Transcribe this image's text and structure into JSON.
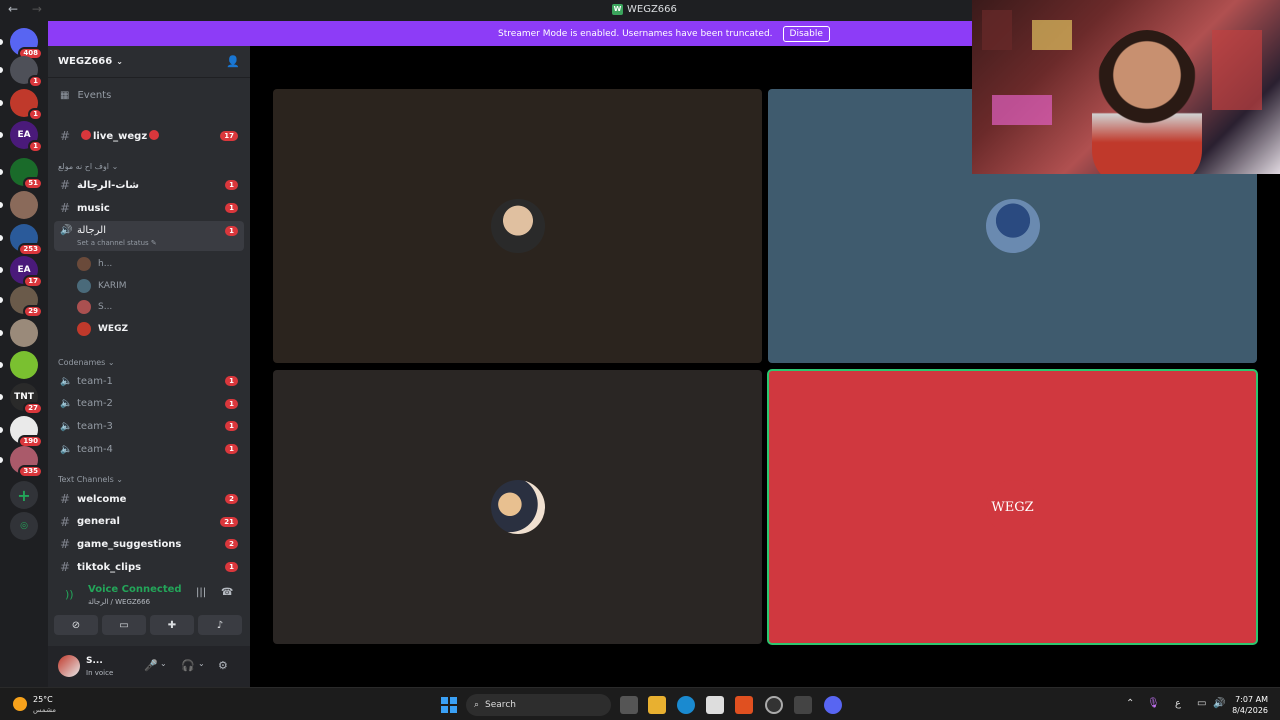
{
  "window": {
    "back": "←",
    "forward": "→",
    "title": "WEGZ666",
    "title_icon": "W"
  },
  "banner": {
    "text": "Streamer Mode is enabled. Usernames have been truncated.",
    "button": "Disable"
  },
  "servers": [
    {
      "name": "discord-home-icon",
      "badge": "408",
      "color": "#5865f2"
    },
    {
      "name": "server-2",
      "badge": "1",
      "color": "#4e5058"
    },
    {
      "name": "server-3",
      "badge": "1",
      "color": "#c0392b"
    },
    {
      "name": "server-ea",
      "badge": "1",
      "color": "#4a1a7a",
      "text": "EA"
    },
    {
      "name": "server-green",
      "badge": "51",
      "color": "#1a6b2a"
    },
    {
      "name": "server-6",
      "badge": "",
      "color": "#8a6a5a"
    },
    {
      "name": "server-7",
      "badge": "253",
      "color": "#2a5a9a"
    },
    {
      "name": "server-ea2",
      "badge": "17",
      "color": "#4a1a7a",
      "text": "EA"
    },
    {
      "name": "server-9",
      "badge": "29",
      "color": "#6a5a4a"
    },
    {
      "name": "server-10",
      "badge": "",
      "color": "#9a8a7a"
    },
    {
      "name": "server-11",
      "badge": "",
      "color": "#7ac030"
    },
    {
      "name": "server-tnt",
      "badge": "27",
      "color": "#2a2a2a",
      "text": "TNT"
    },
    {
      "name": "server-13",
      "badge": "190",
      "color": "#eaeaea"
    },
    {
      "name": "server-14",
      "badge": "335",
      "color": "#aa5a6a"
    }
  ],
  "sidebar": {
    "server_name": "WEGZ666",
    "events": "Events",
    "live_channel": "live_wegz",
    "live_count": "17",
    "category_1": "اوف اح نه مولع",
    "channels_1": [
      {
        "name": "شات-الرجالة",
        "count": "1"
      },
      {
        "name": "music",
        "count": "1"
      }
    ],
    "voice_channel": {
      "name": "الرجالة",
      "sub": "Set a channel status",
      "count": "1"
    },
    "voice_users": [
      {
        "name": "h...",
        "color": "#6a4a3a"
      },
      {
        "name": "KARIM",
        "color": "#4a6a7a"
      },
      {
        "name": "S...",
        "color": "#aa5050"
      },
      {
        "name": "WEGZ",
        "color": "#c0392b"
      }
    ],
    "category_2": "Codenames",
    "team_channels": [
      {
        "name": "team-1",
        "count": "1"
      },
      {
        "name": "team-2",
        "count": "1"
      },
      {
        "name": "team-3",
        "count": "1"
      },
      {
        "name": "team-4",
        "count": "1"
      }
    ],
    "category_3": "Text Channels",
    "text_channels": [
      {
        "name": "welcome",
        "count": "2"
      },
      {
        "name": "general",
        "count": "21"
      },
      {
        "name": "game_suggestions",
        "count": "2"
      },
      {
        "name": "tiktok_clips",
        "count": "1"
      }
    ]
  },
  "voice_panel": {
    "status": "Voice Connected",
    "sub": "الرجالة / WEGZ666"
  },
  "user_panel": {
    "name": "S...",
    "status": "In voice"
  },
  "tiles": [
    {
      "name": "tile-1",
      "bg": "#2b241e",
      "avatar": "#5a5550"
    },
    {
      "name": "tile-2",
      "bg": "#3f5b6e",
      "avatar": "#4a6a90"
    },
    {
      "name": "tile-3",
      "bg": "#2a2624",
      "avatar": "#c8a080"
    },
    {
      "name": "tile-4",
      "bg": "#d0383f",
      "avatar": "#d0383f",
      "label": "WEGZ"
    }
  ],
  "taskbar": {
    "temp": "25°C",
    "weather_desc": "مشمس",
    "search": "Search",
    "lang": "ع",
    "time": "7:07 AM",
    "date": "8/4/2026"
  }
}
